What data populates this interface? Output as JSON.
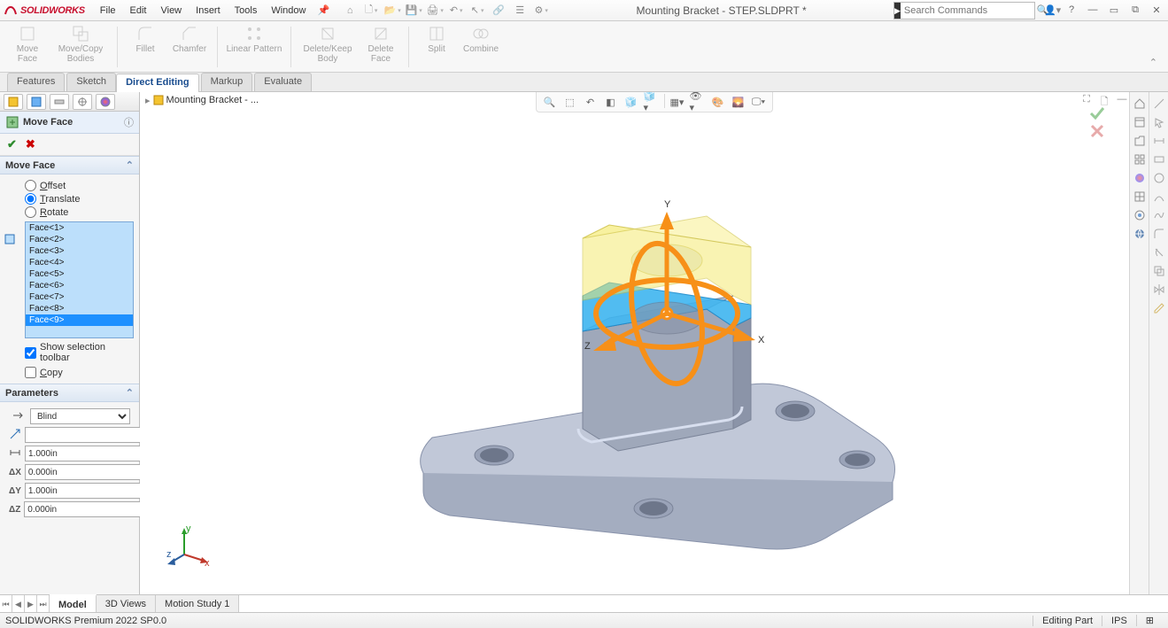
{
  "app_name": "SOLIDWORKS",
  "menus": [
    "File",
    "Edit",
    "View",
    "Insert",
    "Tools",
    "Window"
  ],
  "doc_title": "Mounting Bracket - STEP.SLDPRT *",
  "search_placeholder": "Search Commands",
  "ribbon": {
    "buttons": [
      {
        "label": "Move\nFace"
      },
      {
        "label": "Move/Copy\nBodies"
      },
      {
        "label": "Fillet"
      },
      {
        "label": "Chamfer"
      },
      {
        "label": "Linear Pattern"
      },
      {
        "label": "Delete/Keep\nBody"
      },
      {
        "label": "Delete\nFace"
      },
      {
        "label": "Split"
      },
      {
        "label": "Combine"
      }
    ]
  },
  "tabs": [
    "Features",
    "Sketch",
    "Direct Editing",
    "Markup",
    "Evaluate"
  ],
  "active_tab": "Direct Editing",
  "pm": {
    "title": "Move Face",
    "section1": "Move Face",
    "options": [
      {
        "label": "Offset",
        "checked": false,
        "accel": "O"
      },
      {
        "label": "Translate",
        "checked": true,
        "accel": "T"
      },
      {
        "label": "Rotate",
        "checked": false,
        "accel": "R"
      }
    ],
    "faces": [
      "Face<1>",
      "Face<2>",
      "Face<3>",
      "Face<4>",
      "Face<5>",
      "Face<6>",
      "Face<7>",
      "Face<8>",
      "Face<9>"
    ],
    "selected_face_index": 8,
    "show_sel_toolbar_label": "Show selection toolbar",
    "show_sel_toolbar": true,
    "copy_label": "Copy",
    "copy": false,
    "section2": "Parameters",
    "end_condition": "Blind",
    "direction_ref": "",
    "distance": "1.000in",
    "dx": "0.000in",
    "dy": "1.000in",
    "dz": "0.000in",
    "dx_label": "ΔX",
    "dy_label": "ΔY",
    "dz_label": "ΔZ"
  },
  "breadcrumb": "Mounting Bracket - ...",
  "bottom_tabs": [
    "Model",
    "3D Views",
    "Motion Study 1"
  ],
  "active_bottom_tab": "Model",
  "status_left": "SOLIDWORKS Premium 2022 SP0.0",
  "status_mode": "Editing Part",
  "status_units": "IPS",
  "triad_axes": {
    "x": "x",
    "y": "y",
    "z": "z"
  },
  "model_axes": {
    "x": "X",
    "y": "Y",
    "z": "Z"
  }
}
